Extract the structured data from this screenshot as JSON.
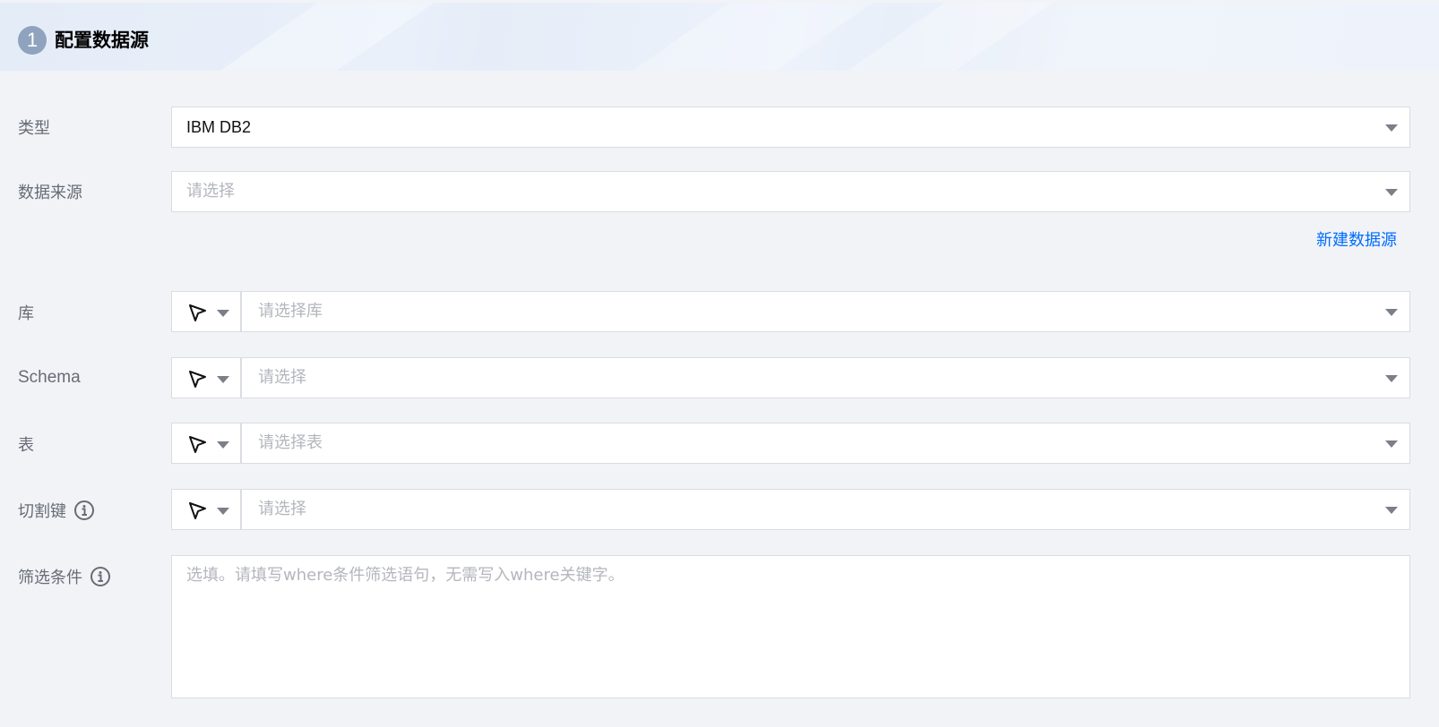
{
  "section": {
    "step_number": "1",
    "title": "配置数据源"
  },
  "form": {
    "type": {
      "label": "类型",
      "value": "IBM DB2"
    },
    "data_source": {
      "label": "数据来源",
      "placeholder": "请选择"
    },
    "new_data_source_link": "新建数据源",
    "database": {
      "label": "库",
      "placeholder": "请选择库"
    },
    "schema": {
      "label": "Schema",
      "placeholder": "请选择"
    },
    "table": {
      "label": "表",
      "placeholder": "请选择表"
    },
    "split_key": {
      "label": "切割键",
      "placeholder": "请选择"
    },
    "filter": {
      "label": "筛选条件",
      "placeholder": "选填。请填写where条件筛选语句，无需写入where关键字。"
    }
  },
  "icons": {
    "mode": "cursor-arrow-icon",
    "info": "info-circle-icon",
    "dropdown": "chevron-down-icon"
  },
  "colors": {
    "background": "#f2f3f7",
    "link": "#006eff",
    "step_circle": "#8fa3be",
    "placeholder": "#b3b6bc",
    "label": "#666c75"
  }
}
